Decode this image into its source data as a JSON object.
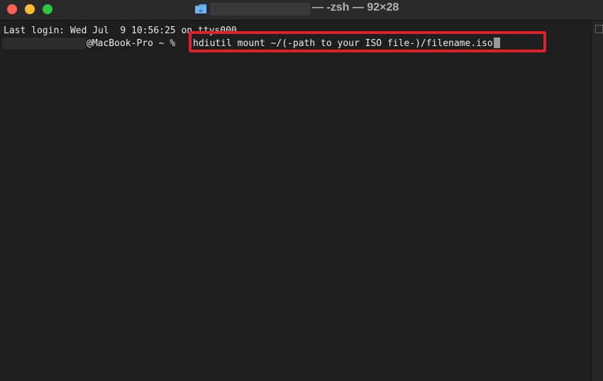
{
  "titlebar": {
    "title": "— -zsh — 92×28"
  },
  "terminal": {
    "last_login": "Last login: Wed Jul  9 10:56:25 on ttys000",
    "prompt": "@MacBook-Pro ~ % ",
    "command": "hdiutil mount ~/(-path to your ISO file-)/filename.iso"
  },
  "colors": {
    "background": "#1e1e1e",
    "text": "#ececec",
    "highlight_border": "#d9222a",
    "close": "#ff5f57",
    "minimize": "#febc2e",
    "zoom": "#28c840"
  }
}
